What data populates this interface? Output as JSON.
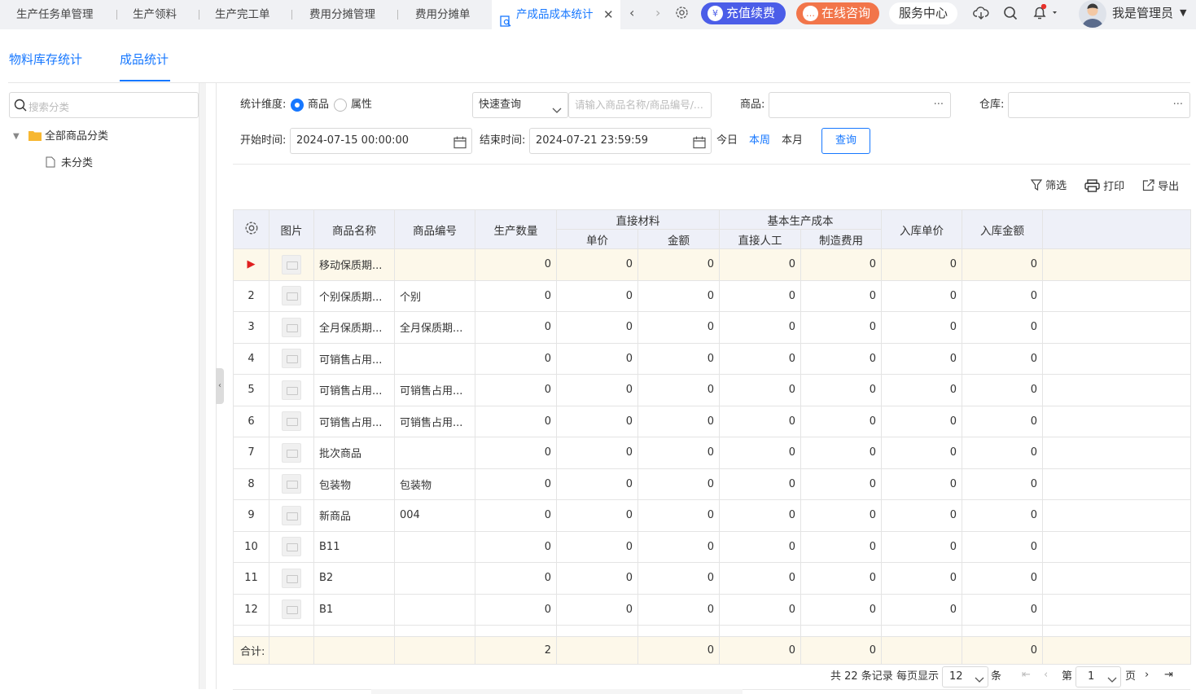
{
  "tabs": [
    "生产任务单管理",
    "生产领料",
    "生产完工单",
    "费用分摊管理",
    "费用分摊单"
  ],
  "active_tab": "产成品成本统计",
  "header": {
    "recharge": "充值续费",
    "consult": "在线咨询",
    "service": "服务中心",
    "user": "我是管理员"
  },
  "subtabs": [
    "物料库存统计",
    "成品统计"
  ],
  "tree": {
    "search_placeholder": "搜索分类",
    "root": "全部商品分类",
    "child": "未分类"
  },
  "filters": {
    "dimension_label": "统计维度:",
    "opt_goods": "商品",
    "opt_attr": "属性",
    "quick_query": "快速查询",
    "goods_search_placeholder": "请输入商品名称/商品编号/...",
    "goods_label": "商品:",
    "warehouse_label": "仓库:",
    "start_label": "开始时间:",
    "start_value": "2024-07-15 00:00:00",
    "end_label": "结束时间:",
    "end_value": "2024-07-21 23:59:59",
    "today": "今日",
    "this_week": "本周",
    "this_month": "本月",
    "query_btn": "查询"
  },
  "toolbar": {
    "filter": "筛选",
    "print": "打印",
    "export": "导出"
  },
  "table": {
    "headers": {
      "image": "图片",
      "name": "商品名称",
      "code": "商品编号",
      "qty": "生产数量",
      "direct_material": "直接材料",
      "unit_price": "单价",
      "amount": "金额",
      "base_cost": "基本生产成本",
      "labor": "直接人工",
      "overhead": "制造费用",
      "in_price": "入库单价",
      "in_amount": "入库金额"
    },
    "rows": [
      {
        "idx": "▶",
        "name": "移动保质期...",
        "code": "",
        "v": [
          "0",
          "0",
          "0",
          "0",
          "0",
          "0",
          "0"
        ]
      },
      {
        "idx": "2",
        "name": "个别保质期...",
        "code": "个别",
        "v": [
          "0",
          "0",
          "0",
          "0",
          "0",
          "0",
          "0"
        ]
      },
      {
        "idx": "3",
        "name": "全月保质期...",
        "code": "全月保质期...",
        "v": [
          "0",
          "0",
          "0",
          "0",
          "0",
          "0",
          "0"
        ]
      },
      {
        "idx": "4",
        "name": "可销售占用...",
        "code": "",
        "v": [
          "0",
          "0",
          "0",
          "0",
          "0",
          "0",
          "0"
        ]
      },
      {
        "idx": "5",
        "name": "可销售占用...",
        "code": "可销售占用...",
        "v": [
          "0",
          "0",
          "0",
          "0",
          "0",
          "0",
          "0"
        ]
      },
      {
        "idx": "6",
        "name": "可销售占用...",
        "code": "可销售占用...",
        "v": [
          "0",
          "0",
          "0",
          "0",
          "0",
          "0",
          "0"
        ]
      },
      {
        "idx": "7",
        "name": "批次商品",
        "code": "",
        "v": [
          "0",
          "0",
          "0",
          "0",
          "0",
          "0",
          "0"
        ]
      },
      {
        "idx": "8",
        "name": "包装物",
        "code": "包装物",
        "v": [
          "0",
          "0",
          "0",
          "0",
          "0",
          "0",
          "0"
        ]
      },
      {
        "idx": "9",
        "name": "新商品",
        "code": "004",
        "v": [
          "0",
          "0",
          "0",
          "0",
          "0",
          "0",
          "0"
        ]
      },
      {
        "idx": "10",
        "name": "B11",
        "code": "",
        "v": [
          "0",
          "0",
          "0",
          "0",
          "0",
          "0",
          "0"
        ]
      },
      {
        "idx": "11",
        "name": "B2",
        "code": "",
        "v": [
          "0",
          "0",
          "0",
          "0",
          "0",
          "0",
          "0"
        ]
      },
      {
        "idx": "12",
        "name": "B1",
        "code": "",
        "v": [
          "0",
          "0",
          "0",
          "0",
          "0",
          "0",
          "0"
        ]
      }
    ],
    "summary": {
      "label": "合计:",
      "qty": "2",
      "amount": "0",
      "labor": "0",
      "overhead": "0",
      "in_amount": "0"
    }
  },
  "pager": {
    "total": "共 22 条记录",
    "per_page_label": "每页显示",
    "per_page": "12",
    "unit": "条",
    "page_prefix": "第",
    "page": "1",
    "page_suffix": "页"
  }
}
